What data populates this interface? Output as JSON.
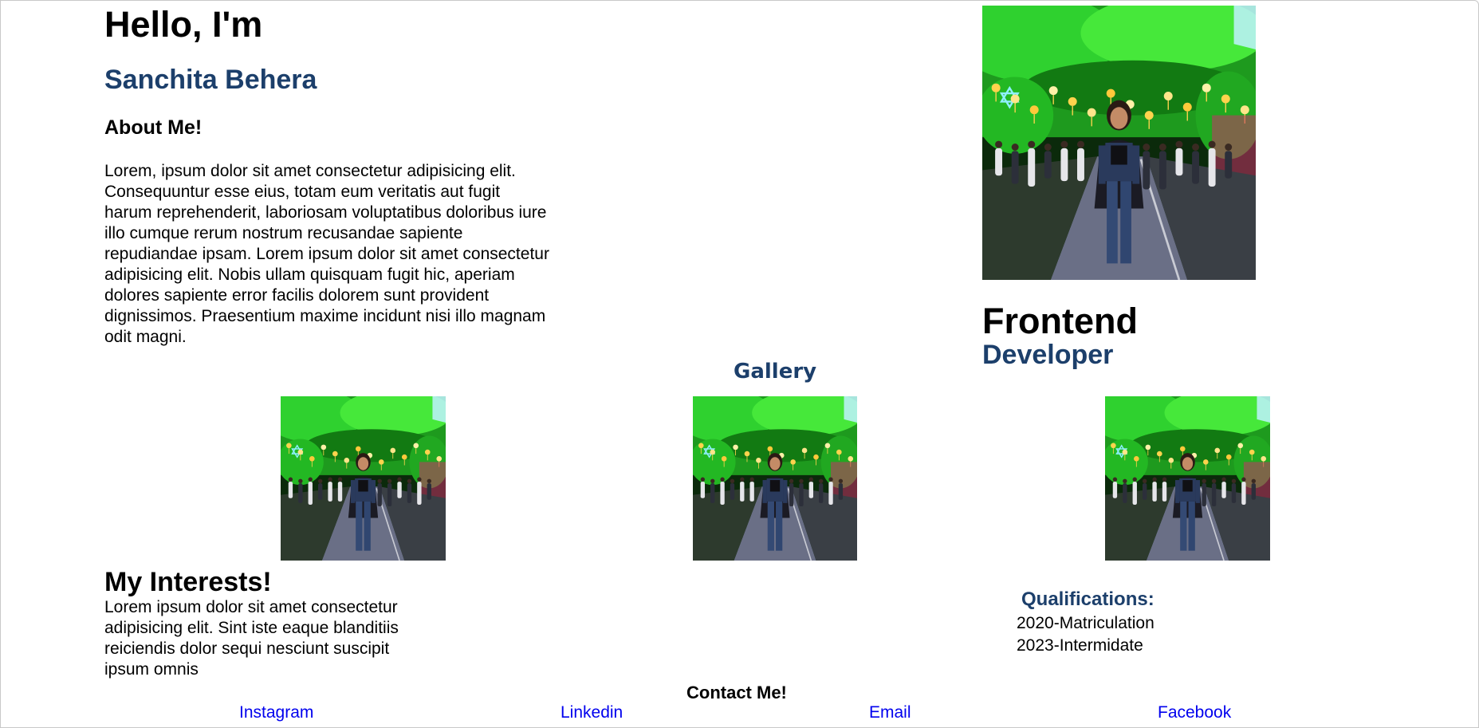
{
  "intro": {
    "greeting": "Hello, I'm",
    "name": "Sanchita Behera",
    "about_heading": "About Me!",
    "about_text": "Lorem, ipsum dolor sit amet consectetur adipisicing elit. Consequuntur esse eius, totam eum veritatis aut fugit harum reprehenderit, laboriosam voluptatibus doloribus iure illo cumque rerum nostrum recusandae sapiente repudiandae ipsam. Lorem ipsum dolor sit amet consectetur adipisicing elit. Nobis ullam quisquam fugit hic, aperiam dolores sapiente error facilis dolorem sunt provident dignissimos. Praesentium maxime incidunt nisi illo magnam odit magni."
  },
  "role": {
    "line1": "Frontend",
    "line2": "Developer"
  },
  "gallery": {
    "heading": "Gallery"
  },
  "interests": {
    "heading": "My Interests!",
    "text": "Lorem ipsum dolor sit amet consectetur adipisicing elit. Sint iste eaque blanditiis reiciendis dolor sequi nesciunt suscipit ipsum omnis"
  },
  "qualifications": {
    "heading": "Qualifications:",
    "items": [
      "2020-Matriculation",
      "2023-Intermidate"
    ]
  },
  "contact": {
    "heading": "Contact Me!",
    "links": [
      "Instagram",
      "Linkedin",
      "Email",
      "Facebook"
    ]
  },
  "colors": {
    "accent_blue": "#1c3f6b",
    "link_blue": "#0000ee"
  }
}
